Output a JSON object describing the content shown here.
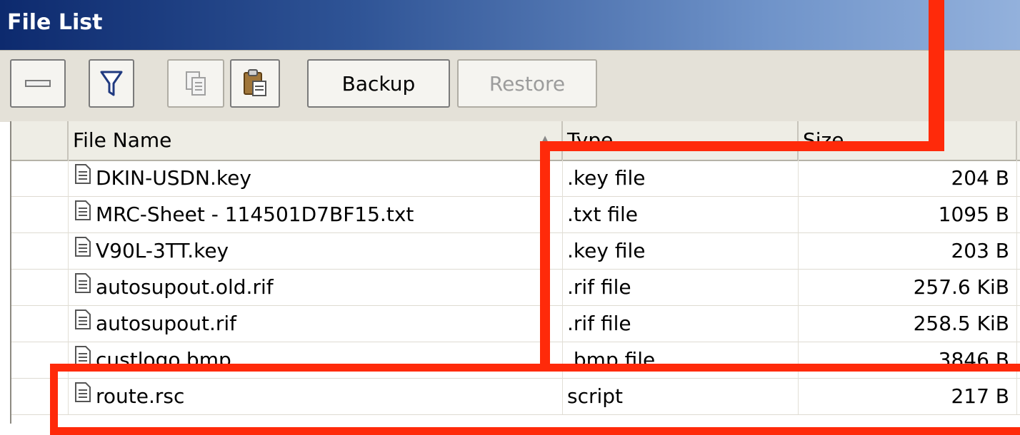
{
  "window": {
    "title": "File List"
  },
  "toolbar": {
    "minimize_icon": "minus-icon",
    "filter_icon": "funnel-icon",
    "copy_icon": "copy-icon",
    "paste_icon": "paste-icon",
    "backup_label": "Backup",
    "restore_label": "Restore"
  },
  "table": {
    "columns": {
      "name": "File Name",
      "type": "Type",
      "size": "Size"
    },
    "rows": [
      {
        "name": "DKIN-USDN.key",
        "type": ".key file",
        "size": "204 B"
      },
      {
        "name": "MRC-Sheet - 114501D7BF15.txt",
        "type": ".txt file",
        "size": "1095 B"
      },
      {
        "name": "V90L-3TT.key",
        "type": ".key file",
        "size": "203 B"
      },
      {
        "name": "autosupout.old.rif",
        "type": ".rif file",
        "size": "257.6 KiB"
      },
      {
        "name": "autosupout.rif",
        "type": ".rif file",
        "size": "258.5 KiB"
      },
      {
        "name": "custlogo.bmp",
        "type": ".bmp file",
        "size": "3846 B"
      },
      {
        "name": "route.rsc",
        "type": "script",
        "size": "217 B"
      }
    ]
  },
  "annotations": {
    "highlight_color": "#ff2a0a"
  }
}
